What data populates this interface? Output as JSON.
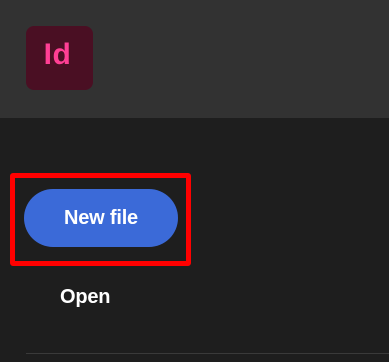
{
  "app": {
    "logo_text": "Id",
    "logo_colors": {
      "background": "#4a0f23",
      "text": "#ff3f94"
    }
  },
  "sidebar": {
    "new_file_label": "New file",
    "open_label": "Open"
  },
  "colors": {
    "header_bg": "#323232",
    "body_bg": "#1e1e1e",
    "primary_button": "#3b6ad8",
    "highlight": "#ff0000"
  }
}
